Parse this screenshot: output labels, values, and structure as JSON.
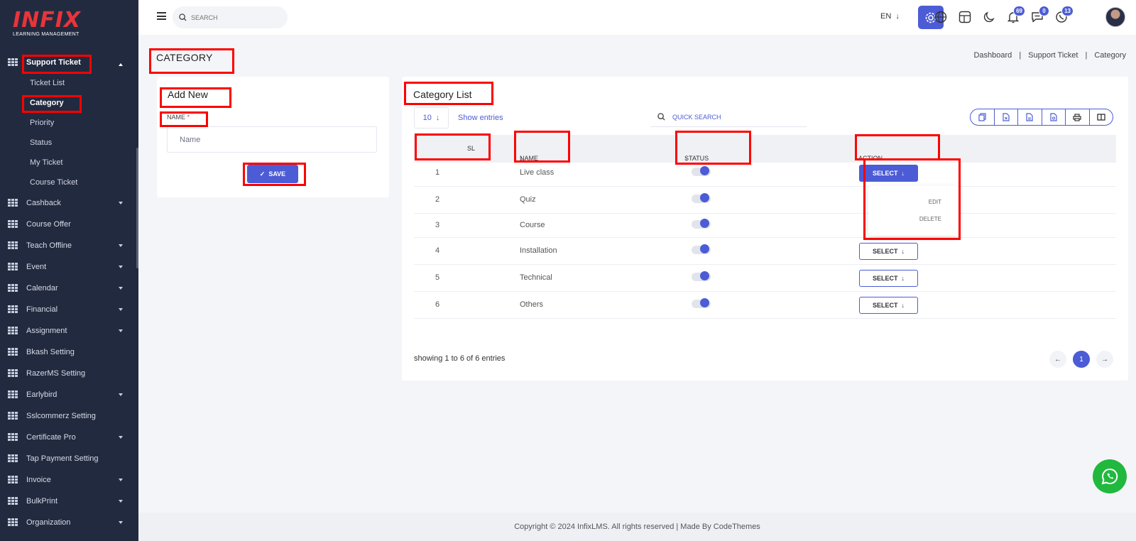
{
  "app": {
    "logo_text": "INFIX",
    "logo_subtitle": "LEARNING MANAGEMENT"
  },
  "sidebar": {
    "items": [
      {
        "label": "Support Ticket",
        "icon": "grid-icon",
        "expanded": true,
        "children": [
          {
            "label": "Ticket List"
          },
          {
            "label": "Category",
            "active": true
          },
          {
            "label": "Priority"
          },
          {
            "label": "Status"
          },
          {
            "label": "My Ticket"
          },
          {
            "label": "Course Ticket"
          }
        ]
      },
      {
        "label": "Cashback",
        "icon": "grid-icon",
        "has_caret": true
      },
      {
        "label": "Course Offer",
        "icon": "grid-icon",
        "has_caret": false
      },
      {
        "label": "Teach Offline",
        "icon": "grid-icon",
        "has_caret": true
      },
      {
        "label": "Event",
        "icon": "grid-icon",
        "has_caret": true
      },
      {
        "label": "Calendar",
        "icon": "grid-icon",
        "has_caret": true
      },
      {
        "label": "Financial",
        "icon": "grid-icon",
        "has_caret": true
      },
      {
        "label": "Assignment",
        "icon": "grid-icon",
        "has_caret": true
      },
      {
        "label": "Bkash Setting",
        "icon": "grid-icon",
        "has_caret": false
      },
      {
        "label": "RazerMS Setting",
        "icon": "grid-icon",
        "has_caret": false
      },
      {
        "label": "Earlybird",
        "icon": "grid-icon",
        "has_caret": true
      },
      {
        "label": "Sslcommerz Setting",
        "icon": "grid-icon",
        "has_caret": false
      },
      {
        "label": "Certificate Pro",
        "icon": "grid-icon",
        "has_caret": true
      },
      {
        "label": "Tap Payment Setting",
        "icon": "grid-icon",
        "has_caret": false
      },
      {
        "label": "Invoice",
        "icon": "grid-icon",
        "has_caret": true
      },
      {
        "label": "BulkPrint",
        "icon": "grid-icon",
        "has_caret": true
      },
      {
        "label": "Organization",
        "icon": "grid-icon",
        "has_caret": true
      }
    ]
  },
  "header": {
    "search_placeholder": "SEARCH",
    "language": "EN",
    "notifications_count": "69",
    "messages_count": "0",
    "calls_count": "13"
  },
  "page": {
    "title": "CATEGORY",
    "breadcrumb": [
      "Dashboard",
      "|",
      "Support Ticket",
      "|",
      "Category"
    ]
  },
  "add_form": {
    "title": "Add New",
    "name_label": "NAME",
    "required_marker": "*",
    "name_placeholder": "Name",
    "save_label": "SAVE"
  },
  "list": {
    "title": "Category List",
    "page_size": "10",
    "show_entries_label": "Show entries",
    "quick_search_placeholder": "QUICK SEARCH",
    "columns": [
      "SL",
      "NAME",
      "STATUS",
      "ACTION"
    ],
    "rows": [
      {
        "sl": "1",
        "name": "Live class",
        "status": true,
        "action": "SELECT"
      },
      {
        "sl": "2",
        "name": "Quiz",
        "status": true,
        "action": "SELECT"
      },
      {
        "sl": "3",
        "name": "Course",
        "status": true,
        "action": "SELECT"
      },
      {
        "sl": "4",
        "name": "Installation",
        "status": true,
        "action": "SELECT"
      },
      {
        "sl": "5",
        "name": "Technical",
        "status": true,
        "action": "SELECT"
      },
      {
        "sl": "6",
        "name": "Others",
        "status": true,
        "action": "SELECT"
      }
    ],
    "dropdown_items": [
      "EDIT",
      "DELETE"
    ],
    "showing_text": "showing 1 to 6 of 6 entries",
    "current_page": "1"
  },
  "footer": {
    "copyright": "Copyright © 2024 InfixLMS. All rights reserved | Made By CodeThemes"
  },
  "colors": {
    "sidebar_bg": "#222a3f",
    "accent": "#4c5cd6",
    "logo_red": "#e8343a",
    "whatsapp": "#21b83e",
    "highlight": "#ff0000"
  }
}
